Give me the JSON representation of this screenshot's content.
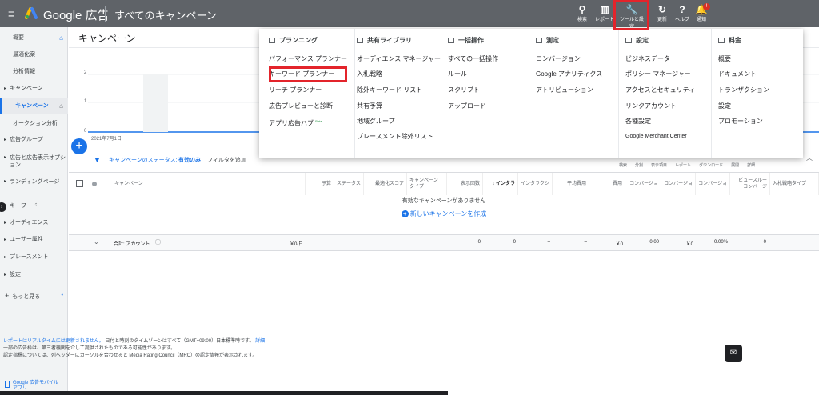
{
  "header": {
    "product": "Google 広告",
    "page_title": "すべてのキャンペーン",
    "buttons": [
      {
        "label": "検索",
        "icon": "search-icon"
      },
      {
        "label": "レポート",
        "icon": "reports-icon"
      },
      {
        "label": "ツールと設定",
        "icon": "wrench-icon"
      },
      {
        "label": "更新",
        "icon": "refresh-icon"
      },
      {
        "label": "ヘルプ",
        "icon": "help-icon"
      },
      {
        "label": "通知",
        "icon": "bell-icon"
      }
    ],
    "notification_badge": "!"
  },
  "sidebar": {
    "items": [
      {
        "label": "概要",
        "group": false
      },
      {
        "label": "最適化案",
        "group": false
      },
      {
        "label": "分析情報",
        "group": false
      },
      {
        "label": "キャンペーン",
        "group": true
      },
      {
        "label": "キャンペーン",
        "group": false,
        "active": true
      },
      {
        "label": "オークション分析",
        "group": false
      },
      {
        "label": "広告グループ",
        "group": true
      },
      {
        "label": "広告と広告表示オプション",
        "group": true
      },
      {
        "label": "ランディングページ",
        "group": true
      },
      {
        "label": "キーワード",
        "group": true
      },
      {
        "label": "オーディエンス",
        "group": true
      },
      {
        "label": "ユーザー属性",
        "group": true
      },
      {
        "label": "プレースメント",
        "group": true
      },
      {
        "label": "設定",
        "group": true
      },
      {
        "label": "もっと見る",
        "group": false
      }
    ],
    "bottom_link": "Google 広告モバイルアプリ"
  },
  "main": {
    "title": "キャンペーン",
    "chart": {
      "y_ticks": [
        "2",
        "1",
        "0"
      ],
      "x_start": "2021年7月1日"
    },
    "filter": {
      "label": "キャンペーンのステータス:",
      "value": "有効のみ",
      "add": "フィルタを追加"
    },
    "toolbar": [
      "検索",
      "分割",
      "表示項目",
      "レポート",
      "ダウンロード",
      "展開",
      "詳細"
    ],
    "columns": [
      "キャンペーン",
      "予算",
      "ステータス",
      "最適化スコア",
      "キャンペーン タイプ",
      "表示回数",
      "インタラ",
      "インタラクシ",
      "平均費用",
      "費用",
      "コンバージョ",
      "コンバージョ",
      "コンバージョ",
      "ビュースルー コンバージ",
      "入札戦略タイプ"
    ],
    "empty_message": "有効なキャンペーンがありません",
    "create_link": "新しいキャンペーンを作成",
    "total_row": {
      "label": "合計: アカウント",
      "budget": "￥0/日",
      "impressions": "0",
      "interactions": "0",
      "interaction_rate": "–",
      "avg_cost": "–",
      "cost": "￥0",
      "conversions": "0.00",
      "cost_per_conv": "￥0",
      "conv_rate": "0.00%",
      "view_through": "0"
    },
    "footer": {
      "line1_link": "レポートはリアルタイムには更新されません。",
      "line1": "日付と時刻のタイムゾーンはすべて（GMT+09:00）日本標準時です。",
      "line1_detail": "詳細",
      "line2": "一部の広告枠は、第三者機関を介して提供されたものである可能性があります。",
      "line3": "認定指標については、列ヘッダーにカーソルを合わせると Media Rating Council（MRC）の認定情報が表示されます。"
    }
  },
  "tools_menu": {
    "columns": [
      {
        "heading": "プランニング",
        "items": [
          "パフォーマンス プランナー",
          "キーワード プランナー",
          "リーチ プランナー",
          "広告プレビューと診断",
          "アプリ広告ハブ"
        ],
        "badge": "Beta"
      },
      {
        "heading": "共有ライブラリ",
        "items": [
          "オーディエンス マネージャー",
          "入札戦略",
          "除外キーワード リスト",
          "共有予算",
          "地域グループ",
          "プレースメント除外リスト"
        ]
      },
      {
        "heading": "一括操作",
        "items": [
          "すべての一括操作",
          "ルール",
          "スクリプト",
          "アップロード"
        ]
      },
      {
        "heading": "測定",
        "items": [
          "コンバージョン",
          "Google アナリティクス",
          "アトリビューション"
        ]
      },
      {
        "heading": "設定",
        "items": [
          "ビジネスデータ",
          "ポリシー マネージャー",
          "アクセスとセキュリティ",
          "リンクアカウント",
          "各種設定",
          "Google Merchant Center"
        ]
      },
      {
        "heading": "料金",
        "items": [
          "概要",
          "ドキュメント",
          "トランザクション",
          "設定",
          "プロモーション"
        ]
      }
    ]
  },
  "colors": {
    "topbar": "#5f6368",
    "accent": "#1a73e8",
    "highlight": "#e3242b"
  }
}
